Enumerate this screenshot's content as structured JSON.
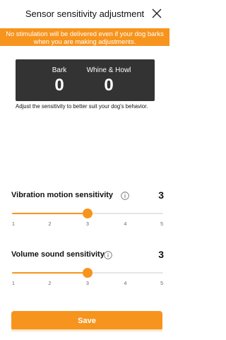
{
  "header": {
    "title": "Sensor sensitivity adjustment"
  },
  "banner": {
    "text": "No stimulation will be delivered even if your dog barks when you are making adjustments."
  },
  "counters": [
    {
      "label": "Bark",
      "value": "0"
    },
    {
      "label": "Whine & Howl",
      "value": "0"
    }
  ],
  "help_text": "Adjust the sensitivity to better suit your dog's behavior.",
  "sliders": [
    {
      "title": "Vibration motion sensitivity",
      "value": "3",
      "level": 3,
      "ticks": [
        "1",
        "2",
        "3",
        "4",
        "5"
      ]
    },
    {
      "title": "Volume sound sensitivity",
      "value": "3",
      "level": 3,
      "ticks": [
        "1",
        "2",
        "3",
        "4",
        "5"
      ]
    }
  ],
  "save_label": "Save",
  "colors": {
    "accent": "#f7941d",
    "dark_panel": "#333333"
  }
}
